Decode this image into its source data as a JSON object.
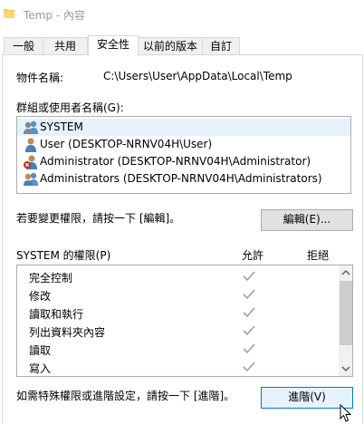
{
  "window": {
    "title": "Temp - 內容"
  },
  "tabs": [
    {
      "label": "一般"
    },
    {
      "label": "共用"
    },
    {
      "label": "安全性"
    },
    {
      "label": "以前的版本"
    },
    {
      "label": "自訂"
    }
  ],
  "object": {
    "label": "物件名稱:",
    "value": "C:\\Users\\User\\AppData\\Local\\Temp"
  },
  "groups": {
    "label": "群組或使用者名稱(G):",
    "items": [
      {
        "label": "SYSTEM",
        "icon": "group-users-icon"
      },
      {
        "label": "User (DESKTOP-NRNV04H\\User)",
        "icon": "user-icon"
      },
      {
        "label": "Administrator (DESKTOP-NRNV04H\\Administrator)",
        "icon": "disabled-user-icon"
      },
      {
        "label": "Administrators (DESKTOP-NRNV04H\\Administrators)",
        "icon": "group-users-icon"
      }
    ],
    "selected_index": 0
  },
  "edit": {
    "hint": "若要變更權限，請按一下 [編輯]。",
    "button": "編輯(E)..."
  },
  "permissions": {
    "title": "SYSTEM 的權限(P)",
    "allow_header": "允許",
    "deny_header": "拒絕",
    "rows": [
      {
        "name": "完全控制",
        "allow": true,
        "deny": false
      },
      {
        "name": "修改",
        "allow": true,
        "deny": false
      },
      {
        "name": "讀取和執行",
        "allow": true,
        "deny": false
      },
      {
        "name": "列出資料夾內容",
        "allow": true,
        "deny": false
      },
      {
        "name": "讀取",
        "allow": true,
        "deny": false
      },
      {
        "name": "寫入",
        "allow": true,
        "deny": false
      }
    ]
  },
  "advanced": {
    "hint": "如需特殊權限或進階設定，請按一下 [進階]。",
    "button": "進階(V)"
  },
  "colors": {
    "selection": "#e5f1fb",
    "accent": "#0078d7",
    "check": "#a0a0a0"
  }
}
